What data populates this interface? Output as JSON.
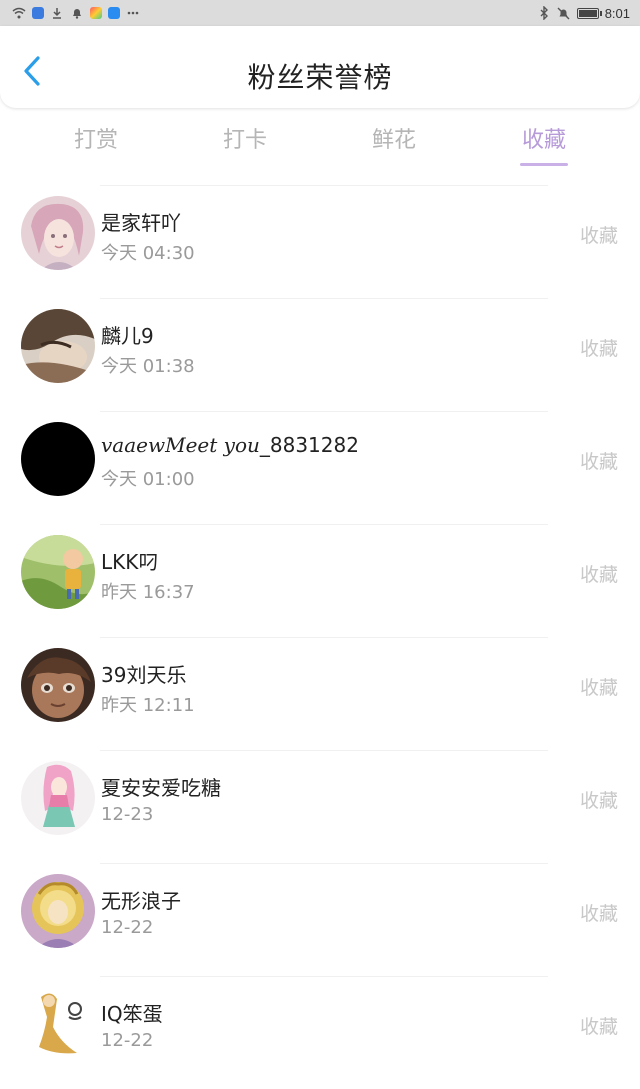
{
  "status_bar": {
    "time": "8:01"
  },
  "header": {
    "title": "粉丝荣誉榜"
  },
  "tabs": [
    {
      "label": "打赏",
      "active": false
    },
    {
      "label": "打卡",
      "active": false
    },
    {
      "label": "鲜花",
      "active": false
    },
    {
      "label": "收藏",
      "active": true
    }
  ],
  "colors": {
    "accent": "#b79bd8",
    "back": "#2a9ee8"
  },
  "fans": [
    {
      "name": "是家轩吖",
      "time": "今天 04:30",
      "action": "收藏"
    },
    {
      "name_script": "vaaewMeet you",
      "name_suffix": "_8831282",
      "time": "今天 01:00",
      "action": "收藏"
    },
    {
      "name": "麟儿9",
      "time": "今天 01:38",
      "action": "收藏"
    },
    {
      "name": "LKK叼",
      "time": "昨天 16:37",
      "action": "收藏"
    },
    {
      "name": "39刘天乐",
      "time": "昨天 12:11",
      "action": "收藏"
    },
    {
      "name": "夏安安爱吃糖",
      "time": "12-23",
      "action": "收藏"
    },
    {
      "name": "无形浪子",
      "time": "12-22",
      "action": "收藏"
    },
    {
      "name": "IQ笨蛋",
      "time": "12-22",
      "action": "收藏"
    }
  ]
}
